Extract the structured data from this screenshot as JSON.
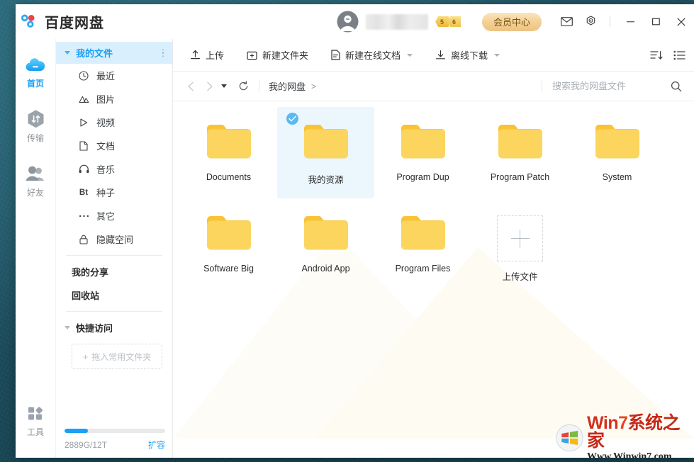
{
  "window": {
    "app_title": "百度网盘",
    "logo_icon": "baidu-cloud-logo",
    "minimize_label": "—",
    "maximize_label": "□",
    "close_label": "✕"
  },
  "titlebar": {
    "avatar_icon": "user-avatar-icon",
    "username": "",
    "vip_badges": [
      "5",
      "6"
    ],
    "vip_button_label": "会员中心",
    "mail_icon": "mail-icon",
    "settings_icon": "gear-icon"
  },
  "rail": {
    "items": [
      {
        "label": "首页",
        "icon": "cloud-icon",
        "active": true
      },
      {
        "label": "传输",
        "icon": "transfer-icon",
        "active": false
      },
      {
        "label": "好友",
        "icon": "friends-icon",
        "active": false
      }
    ],
    "bottom": {
      "label": "工具",
      "icon": "tools-icon"
    }
  },
  "sidebar": {
    "header": {
      "label": "我的文件",
      "menu_icon": "more-vertical-icon",
      "expanded": true
    },
    "items": [
      {
        "label": "最近",
        "icon": "clock-icon"
      },
      {
        "label": "图片",
        "icon": "image-icon"
      },
      {
        "label": "视频",
        "icon": "video-icon"
      },
      {
        "label": "文档",
        "icon": "document-icon"
      },
      {
        "label": "音乐",
        "icon": "music-icon"
      },
      {
        "label": "种子",
        "icon": "bt-icon"
      },
      {
        "label": "其它",
        "icon": "ellipsis-icon"
      },
      {
        "label": "隐藏空间",
        "icon": "lock-icon"
      }
    ],
    "links": [
      {
        "label": "我的分享"
      },
      {
        "label": "回收站"
      }
    ],
    "quick_access": {
      "label": "快捷访问",
      "dropzone_label": "拖入常用文件夹",
      "dropzone_plus": "+"
    },
    "quota": {
      "text": "2889G/12T",
      "link_label": "扩容",
      "percent": 23,
      "bar_color": "#19a0f7"
    }
  },
  "toolbar": {
    "buttons": [
      {
        "label": "上传",
        "icon": "upload-icon",
        "has_caret": false
      },
      {
        "label": "新建文件夹",
        "icon": "new-folder-icon",
        "has_caret": false
      },
      {
        "label": "新建在线文档",
        "icon": "new-doc-icon",
        "has_caret": true
      },
      {
        "label": "离线下载",
        "icon": "download-icon",
        "has_caret": true
      }
    ],
    "sort_icon": "sort-icon",
    "view_icon": "list-view-icon"
  },
  "navbar": {
    "back_icon": "chevron-left-icon",
    "forward_icon": "chevron-right-icon",
    "history_caret_icon": "caret-down-icon",
    "refresh_icon": "refresh-icon",
    "breadcrumb": [
      {
        "label": "我的网盘"
      }
    ],
    "breadcrumb_separator": ">"
  },
  "search": {
    "placeholder": "搜索我的网盘文件",
    "value": "",
    "icon": "search-icon"
  },
  "files": {
    "items": [
      {
        "name": "Documents",
        "type": "folder",
        "selected": false
      },
      {
        "name": "我的资源",
        "type": "folder",
        "selected": true
      },
      {
        "name": "Program Dup",
        "type": "folder",
        "selected": false
      },
      {
        "name": "Program Patch",
        "type": "folder",
        "selected": false
      },
      {
        "name": "System",
        "type": "folder",
        "selected": false
      },
      {
        "name": "Software Big",
        "type": "folder",
        "selected": false
      },
      {
        "name": "Android App",
        "type": "folder",
        "selected": false
      },
      {
        "name": "Program Files",
        "type": "folder",
        "selected": false
      },
      {
        "name": "上传文件",
        "type": "upload-tile",
        "selected": false
      }
    ],
    "folder_color": "#fbd55e",
    "folder_tab_color": "#f9c335",
    "selected_bg": "#ebf6fd",
    "check_color": "#5bb9ef"
  },
  "watermark": {
    "brand_prefix": "Win",
    "brand_number": "7",
    "brand_cn": "系统之家",
    "url": "Www.Winwin7.com",
    "logo_icon": "windows-logo-icon"
  },
  "colors": {
    "accent": "#19a0f7",
    "header_highlight": "#d9effd",
    "vip_gold": "#edc383",
    "desktop": "#1d5566"
  }
}
